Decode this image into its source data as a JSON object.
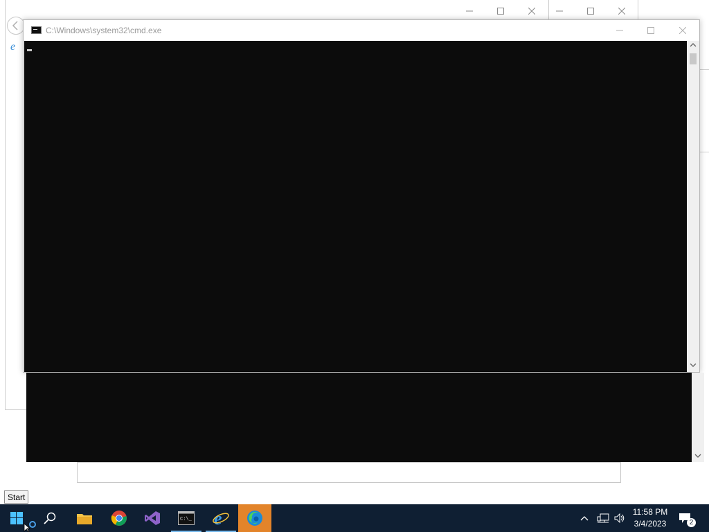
{
  "windows": {
    "cmd": {
      "title": "C:\\Windows\\system32\\cmd.exe"
    }
  },
  "tooltip": {
    "start": "Start"
  },
  "taskbar": {
    "apps": [
      {
        "name": "start",
        "icon": "windows-logo-icon"
      },
      {
        "name": "search",
        "icon": "search-icon"
      },
      {
        "name": "file-explorer",
        "icon": "folder-icon"
      },
      {
        "name": "chrome",
        "icon": "chrome-icon"
      },
      {
        "name": "visual-studio",
        "icon": "visual-studio-icon"
      },
      {
        "name": "command-prompt",
        "icon": "cmd-icon"
      },
      {
        "name": "internet-explorer",
        "icon": "ie-icon"
      },
      {
        "name": "edge",
        "icon": "edge-icon"
      }
    ],
    "clock": {
      "time": "11:58 PM",
      "date": "3/4/2023"
    },
    "notifications_count": "2"
  },
  "colors": {
    "taskbar": "#0f1f33",
    "active_app": "#e3842a",
    "console_bg": "#0c0c0c"
  }
}
